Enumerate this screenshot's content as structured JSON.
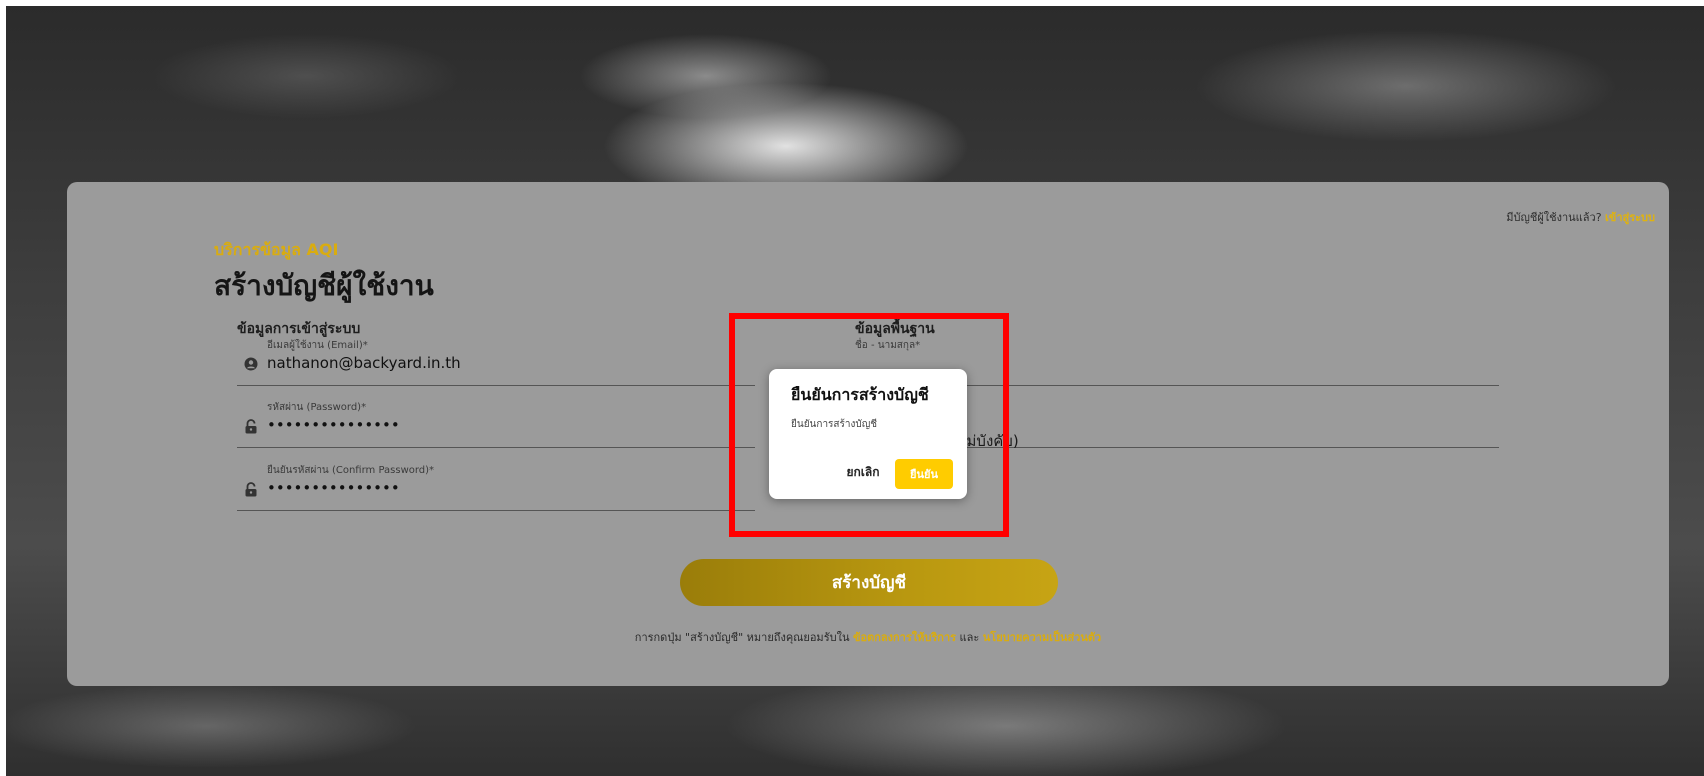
{
  "header": {
    "signin_prompt": "มีบัญชีผู้ใช้งานแล้ว?",
    "signin_link": "เข้าสู่ระบบ"
  },
  "page": {
    "brand": "บริการข้อมูล AQI",
    "title": "สร้างบัญชีผู้ใช้งาน"
  },
  "login_section": {
    "title": "ข้อมูลการเข้าสู่ระบบ",
    "email_label": "อีเมลผู้ใช้งาน (Email)*",
    "email_value": "nathanon@backyard.in.th",
    "password_label": "รหัสผ่าน (Password)*",
    "password_value": "•••••••••••••••",
    "confirm_label": "ยืนยันรหัสผ่าน (Confirm Password)*",
    "confirm_value": "•••••••••••••••"
  },
  "basic_section": {
    "title": "ข้อมูลพื้นฐาน",
    "name_label": "ชื่อ - นามสกุล*",
    "optional_hint": "ไม่บังคับ)"
  },
  "create_button": "สร้างบัญชี",
  "terms": {
    "prefix": "การกดปุ่ม \"สร้างบัญชี\" หมายถึงคุณยอมรับใน",
    "terms_link": "ข้อตกลงการให้บริการ",
    "and": "และ",
    "privacy_link": "นโยบายความเป็นส่วนตัว"
  },
  "modal": {
    "title": "ยืนยันการสร้างบัญชี",
    "body": "ยืนยันการสร้างบัญชี",
    "cancel": "ยกเลิก",
    "confirm": "ยืนยัน"
  },
  "colors": {
    "accent": "#ffcc00",
    "highlight": "#ff0000"
  },
  "icons": {
    "email_field": "user-circle-icon",
    "password_field": "lock-icon",
    "confirm_field": "lock-icon"
  }
}
